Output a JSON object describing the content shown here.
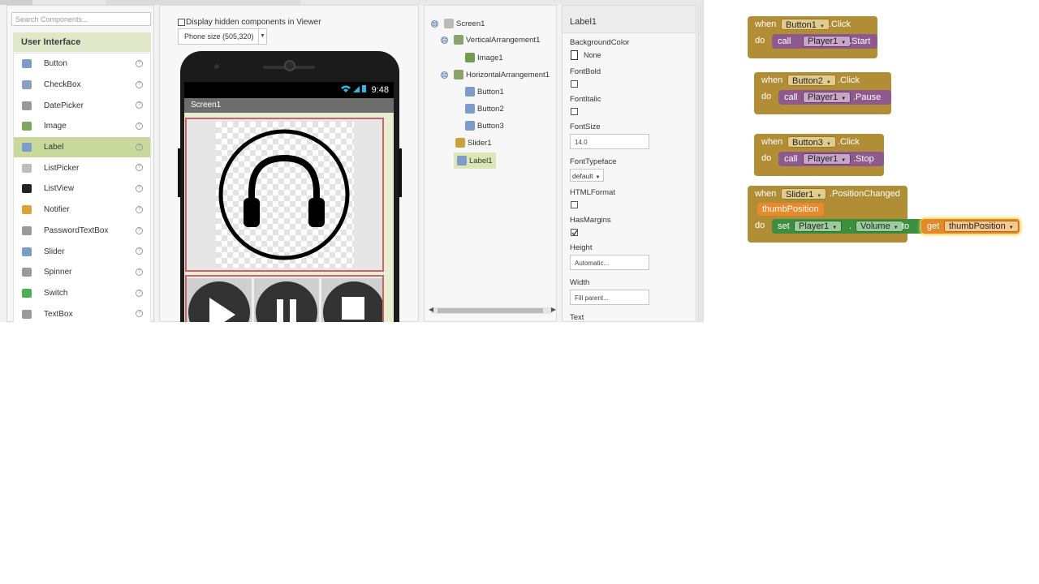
{
  "palette": {
    "search_placeholder": "Search Components...",
    "category": "User Interface",
    "items": [
      {
        "label": "Button",
        "icon": "button-icon",
        "color": "#7d9cc9"
      },
      {
        "label": "CheckBox",
        "icon": "checkbox-icon",
        "color": "#8aa0be"
      },
      {
        "label": "DatePicker",
        "icon": "calendar-icon",
        "color": "#9a9a9a"
      },
      {
        "label": "Image",
        "icon": "image-icon",
        "color": "#7ea65e"
      },
      {
        "label": "Label",
        "icon": "label-icon",
        "color": "#7d9cc9"
      },
      {
        "label": "ListPicker",
        "icon": "list-icon",
        "color": "#bdbdbd"
      },
      {
        "label": "ListView",
        "icon": "listview-icon",
        "color": "#222222"
      },
      {
        "label": "Notifier",
        "icon": "warning-icon",
        "color": "#d9a53a"
      },
      {
        "label": "PasswordTextBox",
        "icon": "password-icon",
        "color": "#9a9a9a"
      },
      {
        "label": "Slider",
        "icon": "slider-icon",
        "color": "#7d9cc9"
      },
      {
        "label": "Spinner",
        "icon": "spinner-icon",
        "color": "#9a9a9a"
      },
      {
        "label": "Switch",
        "icon": "switch-icon",
        "color": "#4caf50"
      },
      {
        "label": "TextBox",
        "icon": "textbox-icon",
        "color": "#9a9a9a"
      }
    ],
    "help_glyph": "?"
  },
  "viewer": {
    "hidden_label": "Display hidden components in Viewer",
    "phone_size": "Phone size (505,320)",
    "status_time": "9:48",
    "status_icons": "wifi-signal-battery-icons",
    "screen_title": "Screen1"
  },
  "tree": {
    "nodes": [
      {
        "label": "Screen1",
        "icon": "screen-icon",
        "expanded": true
      },
      {
        "label": "VerticalArrangement1",
        "icon": "vertical-arrangement-icon",
        "expanded": true
      },
      {
        "label": "Image1",
        "icon": "image-icon"
      },
      {
        "label": "HorizontalArrangement1",
        "icon": "horizontal-arrangement-icon",
        "expanded": true
      },
      {
        "label": "Button1",
        "icon": "button-icon"
      },
      {
        "label": "Button2",
        "icon": "button-icon"
      },
      {
        "label": "Button3",
        "icon": "button-icon"
      },
      {
        "label": "Slider1",
        "icon": "slider-icon"
      },
      {
        "label": "Label1",
        "icon": "label-icon",
        "selected": true
      }
    ],
    "expand_glyph": "⊟"
  },
  "properties": {
    "component": "Label1",
    "background_label": "BackgroundColor",
    "background_value": "None",
    "fontbold_label": "FontBold",
    "fontitalic_label": "FontItalic",
    "fontsize_label": "FontSize",
    "fontsize_value": "14.0",
    "fonttypeface_label": "FontTypeface",
    "fonttypeface_value": "default",
    "htmlformat_label": "HTMLFormat",
    "hasmargins_label": "HasMargins",
    "hasmargins_checked": true,
    "height_label": "Height",
    "height_value": "Automatic...",
    "width_label": "Width",
    "width_value": "Fill parent...",
    "text_label": "Text"
  },
  "blocks": {
    "b1": {
      "when": "when",
      "component": "Button1",
      "event": ".Click",
      "do": "do",
      "call": "call",
      "target": "Player1",
      "method": ".Start"
    },
    "b2": {
      "when": "when",
      "component": "Button2",
      "event": ".Click",
      "do": "do",
      "call": "call",
      "target": "Player1",
      "method": ".Pause"
    },
    "b3": {
      "when": "when",
      "component": "Button3",
      "event": ".Click",
      "do": "do",
      "call": "call",
      "target": "Player1",
      "method": ".Stop"
    },
    "b4": {
      "when": "when",
      "component": "Slider1",
      "event": ".PositionChanged",
      "param": "thumbPosition",
      "do": "do",
      "set": "set",
      "target": "Player1",
      "dot": ".",
      "property": "Volume",
      "to": "to",
      "get": "get",
      "get_var": "thumbPosition"
    }
  }
}
